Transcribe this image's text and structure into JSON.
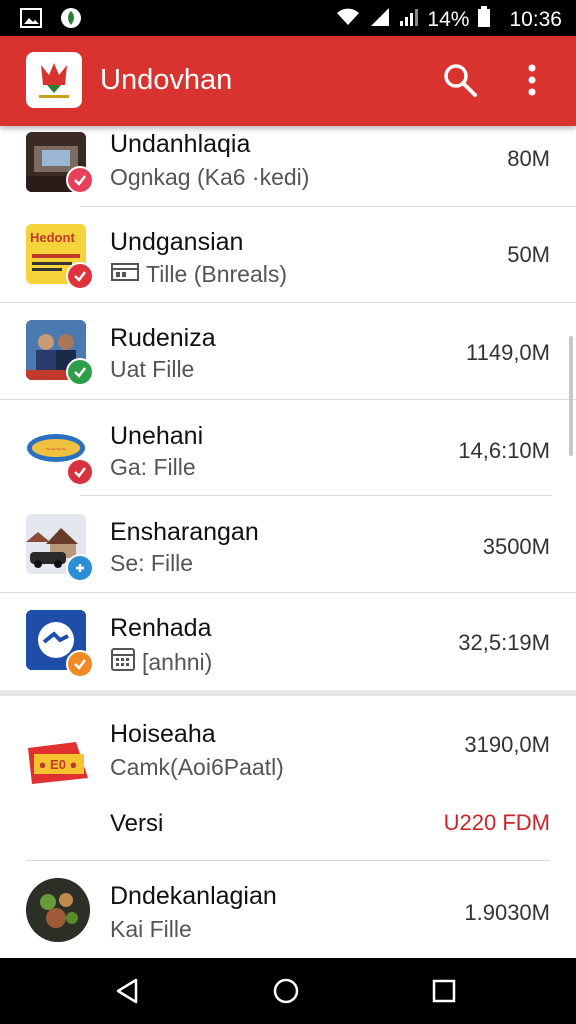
{
  "status_bar": {
    "battery_percent": "14%",
    "time": "10:36",
    "left_icons": [
      "image-icon",
      "shield-leaf-icon"
    ],
    "right_icons": [
      "wifi-icon",
      "signal-icon",
      "battery-icon"
    ]
  },
  "app_bar": {
    "title": "Undovhan",
    "color": "#d9332f",
    "actions": [
      "search-icon",
      "more-vert-icon"
    ]
  },
  "rows": [
    {
      "title": "Undanhlaqia",
      "subtitle": "Ognkag (Ka6 ·kedi)",
      "size": "80M",
      "badge_color": "#e8405a"
    },
    {
      "title": "Undgansian",
      "subtitle": "Tille (Bnreals)",
      "size": "50M",
      "badge_color": "#e0323c"
    },
    {
      "title": "Rudeniza",
      "subtitle": "Uat Fille",
      "size": "1149,0M",
      "badge_color": "#2e9e48"
    },
    {
      "title": "Unehani",
      "subtitle": "Ga: Fille",
      "size": "14,6:10M",
      "badge_color": "#d9323f"
    },
    {
      "title": "Ensharangan",
      "subtitle": "Se: Fille",
      "size": "3500M",
      "badge_color": "#2a8fd6"
    },
    {
      "title": "Renhada",
      "subtitle": "[anhni)",
      "size": "32,5:19M",
      "badge_color": "#f08a24"
    },
    {
      "title": "Hoiseaha",
      "subtitle": "Camk(Aoi6Paatl)",
      "size": "3190,0M",
      "version_label": "Versi",
      "version_value": "U220 FDM",
      "version_color": "#c8262c"
    },
    {
      "title": "Dndekanlagian",
      "subtitle": "Kai Fille",
      "size": "1.9030M"
    }
  ],
  "thumb_text": {
    "row2": "Hedont"
  },
  "nav_bar": {
    "buttons": [
      "back-icon",
      "home-icon",
      "recents-icon"
    ]
  }
}
